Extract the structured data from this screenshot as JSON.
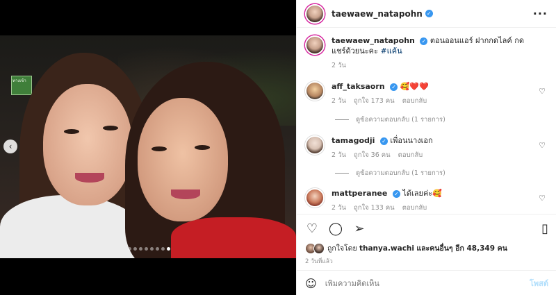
{
  "post": {
    "username": "taewaew_natapohn",
    "caption": "ตอนออนแอร์ ฝากกดไลค์ กดแชร์ด้วยนะคะ",
    "hashtag": "#แค้น",
    "caption_time": "2 วัน"
  },
  "carousel": {
    "slides": 8,
    "active_index": 7
  },
  "comments": [
    {
      "username": "aff_taksaorn",
      "text": "🥰❤️❤️",
      "time": "2 วัน",
      "likes": "ถูกใจ 173 คน",
      "reply": "ตอบกลับ",
      "view_replies": "ดูข้อความตอบกลับ (1 รายการ)"
    },
    {
      "username": "tamagodji",
      "text": "เพื่อนนางเอก",
      "time": "2 วัน",
      "likes": "ถูกใจ 36 คน",
      "reply": "ตอบกลับ",
      "view_replies": "ดูข้อความตอบกลับ (1 รายการ)"
    },
    {
      "username": "mattperanee",
      "text": "ได้เลยค่ะ🥰",
      "time": "2 วัน",
      "likes": "ถูกใจ 133 คน",
      "reply": "ตอบกลับ"
    }
  ],
  "likes": {
    "prefix": "ถูกใจโดย",
    "first_user": "thanya.wachi",
    "suffix": "และคนอื่นๆ อีก 48,349 คน"
  },
  "time_ago": "2 วันที่แล้ว",
  "comment_input": {
    "placeholder": "เพิ่มความคิดเห็น",
    "post_label": "โพสต์"
  },
  "photo_sign_text": "ทางเข้า",
  "colors": {
    "verified": "#3897f0",
    "link": "#00376b",
    "post_disabled": "#b2dffc"
  }
}
